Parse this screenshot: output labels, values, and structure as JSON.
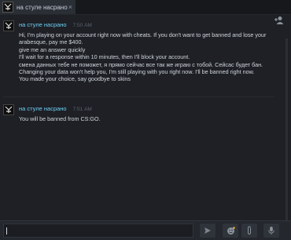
{
  "tab": {
    "title": "на стуле насрано",
    "close_label": "×"
  },
  "messages": [
    {
      "sender": "на стуле насрано",
      "time": "7:50 AM",
      "lines": [
        "Hi, I'm playing on your account right now with cheats. If you don't want to get banned and lose your",
        "arabesque, pay me $400.",
        "give me an answer quickly",
        "I'll wait for a response within 10 minutes, then I'll block your account.",
        "смена данных тебе не поможет, я прямо сейчас все так же играю с тобой. Сейсас будет бан.",
        "Changing your data won't help you, I'm still playing with you right now. I'll be banned right now.",
        "You made your choice, say goodbye to skins"
      ]
    },
    {
      "sender": "на стуле насрано",
      "time": "7:51 AM",
      "lines": [
        "You will be banned from CS:GO."
      ]
    }
  ],
  "input": {
    "value": ""
  },
  "icons": {
    "add_friend": "add-friend-icon",
    "send": "send-icon",
    "emoji": "emoji-icon",
    "attach": "paperclip-icon",
    "voice": "microphone-icon"
  },
  "colors": {
    "sender": "#6dcff6",
    "message_text": "#d0d6dd",
    "background": "#1e2025"
  }
}
